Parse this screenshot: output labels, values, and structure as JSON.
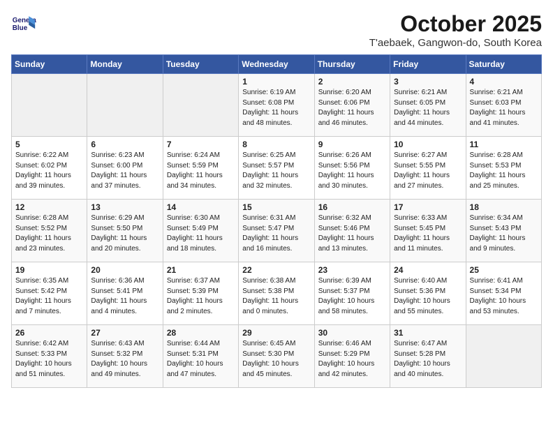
{
  "logo": {
    "line1": "General",
    "line2": "Blue"
  },
  "title": "October 2025",
  "subtitle": "T'aebaek, Gangwon-do, South Korea",
  "days_of_week": [
    "Sunday",
    "Monday",
    "Tuesday",
    "Wednesday",
    "Thursday",
    "Friday",
    "Saturday"
  ],
  "weeks": [
    [
      {
        "day": "",
        "empty": true
      },
      {
        "day": "",
        "empty": true
      },
      {
        "day": "",
        "empty": true
      },
      {
        "day": "1",
        "sunrise": "6:19 AM",
        "sunset": "6:08 PM",
        "daylight": "11 hours and 48 minutes."
      },
      {
        "day": "2",
        "sunrise": "6:20 AM",
        "sunset": "6:06 PM",
        "daylight": "11 hours and 46 minutes."
      },
      {
        "day": "3",
        "sunrise": "6:21 AM",
        "sunset": "6:05 PM",
        "daylight": "11 hours and 44 minutes."
      },
      {
        "day": "4",
        "sunrise": "6:21 AM",
        "sunset": "6:03 PM",
        "daylight": "11 hours and 41 minutes."
      }
    ],
    [
      {
        "day": "5",
        "sunrise": "6:22 AM",
        "sunset": "6:02 PM",
        "daylight": "11 hours and 39 minutes."
      },
      {
        "day": "6",
        "sunrise": "6:23 AM",
        "sunset": "6:00 PM",
        "daylight": "11 hours and 37 minutes."
      },
      {
        "day": "7",
        "sunrise": "6:24 AM",
        "sunset": "5:59 PM",
        "daylight": "11 hours and 34 minutes."
      },
      {
        "day": "8",
        "sunrise": "6:25 AM",
        "sunset": "5:57 PM",
        "daylight": "11 hours and 32 minutes."
      },
      {
        "day": "9",
        "sunrise": "6:26 AM",
        "sunset": "5:56 PM",
        "daylight": "11 hours and 30 minutes."
      },
      {
        "day": "10",
        "sunrise": "6:27 AM",
        "sunset": "5:55 PM",
        "daylight": "11 hours and 27 minutes."
      },
      {
        "day": "11",
        "sunrise": "6:28 AM",
        "sunset": "5:53 PM",
        "daylight": "11 hours and 25 minutes."
      }
    ],
    [
      {
        "day": "12",
        "sunrise": "6:28 AM",
        "sunset": "5:52 PM",
        "daylight": "11 hours and 23 minutes."
      },
      {
        "day": "13",
        "sunrise": "6:29 AM",
        "sunset": "5:50 PM",
        "daylight": "11 hours and 20 minutes."
      },
      {
        "day": "14",
        "sunrise": "6:30 AM",
        "sunset": "5:49 PM",
        "daylight": "11 hours and 18 minutes."
      },
      {
        "day": "15",
        "sunrise": "6:31 AM",
        "sunset": "5:47 PM",
        "daylight": "11 hours and 16 minutes."
      },
      {
        "day": "16",
        "sunrise": "6:32 AM",
        "sunset": "5:46 PM",
        "daylight": "11 hours and 13 minutes."
      },
      {
        "day": "17",
        "sunrise": "6:33 AM",
        "sunset": "5:45 PM",
        "daylight": "11 hours and 11 minutes."
      },
      {
        "day": "18",
        "sunrise": "6:34 AM",
        "sunset": "5:43 PM",
        "daylight": "11 hours and 9 minutes."
      }
    ],
    [
      {
        "day": "19",
        "sunrise": "6:35 AM",
        "sunset": "5:42 PM",
        "daylight": "11 hours and 7 minutes."
      },
      {
        "day": "20",
        "sunrise": "6:36 AM",
        "sunset": "5:41 PM",
        "daylight": "11 hours and 4 minutes."
      },
      {
        "day": "21",
        "sunrise": "6:37 AM",
        "sunset": "5:39 PM",
        "daylight": "11 hours and 2 minutes."
      },
      {
        "day": "22",
        "sunrise": "6:38 AM",
        "sunset": "5:38 PM",
        "daylight": "11 hours and 0 minutes."
      },
      {
        "day": "23",
        "sunrise": "6:39 AM",
        "sunset": "5:37 PM",
        "daylight": "10 hours and 58 minutes."
      },
      {
        "day": "24",
        "sunrise": "6:40 AM",
        "sunset": "5:36 PM",
        "daylight": "10 hours and 55 minutes."
      },
      {
        "day": "25",
        "sunrise": "6:41 AM",
        "sunset": "5:34 PM",
        "daylight": "10 hours and 53 minutes."
      }
    ],
    [
      {
        "day": "26",
        "sunrise": "6:42 AM",
        "sunset": "5:33 PM",
        "daylight": "10 hours and 51 minutes."
      },
      {
        "day": "27",
        "sunrise": "6:43 AM",
        "sunset": "5:32 PM",
        "daylight": "10 hours and 49 minutes."
      },
      {
        "day": "28",
        "sunrise": "6:44 AM",
        "sunset": "5:31 PM",
        "daylight": "10 hours and 47 minutes."
      },
      {
        "day": "29",
        "sunrise": "6:45 AM",
        "sunset": "5:30 PM",
        "daylight": "10 hours and 45 minutes."
      },
      {
        "day": "30",
        "sunrise": "6:46 AM",
        "sunset": "5:29 PM",
        "daylight": "10 hours and 42 minutes."
      },
      {
        "day": "31",
        "sunrise": "6:47 AM",
        "sunset": "5:28 PM",
        "daylight": "10 hours and 40 minutes."
      },
      {
        "day": "",
        "empty": true
      }
    ]
  ]
}
